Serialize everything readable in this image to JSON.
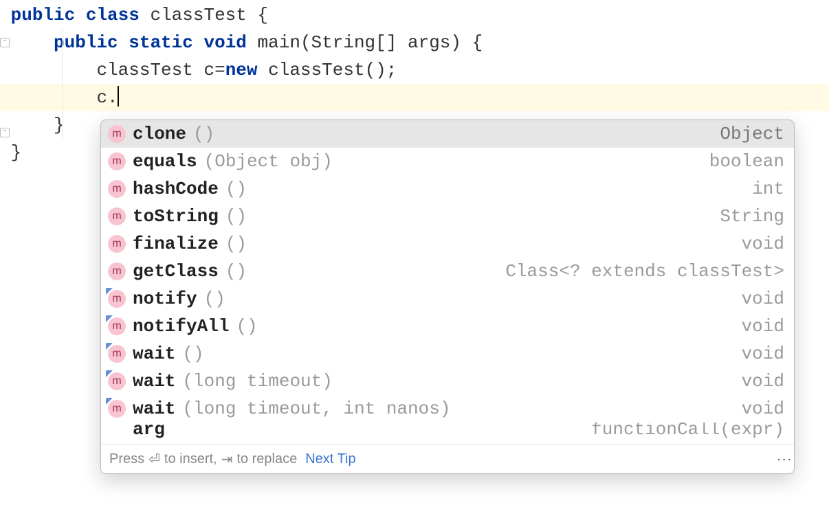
{
  "code": {
    "line1": {
      "kw_public": "public",
      "kw_class": "class",
      "className": "classTest",
      "brace": "{"
    },
    "line2": {
      "kw_public": "public",
      "kw_static": "static",
      "kw_void": "void",
      "methodName": "main",
      "params_open": "(",
      "paramType": "String",
      "brackets": "[]",
      "paramName": "args",
      "params_close": ")",
      "brace": "{"
    },
    "line3": {
      "type": "classTest",
      "var": "c",
      "equals": "=",
      "kw_new": "new",
      "ctor": "classTest",
      "parens": "()",
      "semi": ";"
    },
    "line4": {
      "obj": "c",
      "dot": "."
    },
    "line5": {
      "brace": "}"
    },
    "line6": {
      "brace": "}"
    }
  },
  "completion": {
    "items": [
      {
        "icon": "m",
        "final": false,
        "name": "clone",
        "params": "()",
        "type": "Object",
        "selected": true
      },
      {
        "icon": "m",
        "final": false,
        "name": "equals",
        "params": "(Object obj)",
        "type": "boolean",
        "selected": false
      },
      {
        "icon": "m",
        "final": false,
        "name": "hashCode",
        "params": "()",
        "type": "int",
        "selected": false
      },
      {
        "icon": "m",
        "final": false,
        "name": "toString",
        "params": "()",
        "type": "String",
        "selected": false
      },
      {
        "icon": "m",
        "final": false,
        "name": "finalize",
        "params": "()",
        "type": "void",
        "selected": false
      },
      {
        "icon": "m",
        "final": false,
        "name": "getClass",
        "params": "()",
        "type": "Class<? extends classTest>",
        "selected": false
      },
      {
        "icon": "m",
        "final": true,
        "name": "notify",
        "params": "()",
        "type": "void",
        "selected": false
      },
      {
        "icon": "m",
        "final": true,
        "name": "notifyAll",
        "params": "()",
        "type": "void",
        "selected": false
      },
      {
        "icon": "m",
        "final": true,
        "name": "wait",
        "params": "()",
        "type": "void",
        "selected": false
      },
      {
        "icon": "m",
        "final": true,
        "name": "wait",
        "params": "(long timeout)",
        "type": "void",
        "selected": false
      },
      {
        "icon": "m",
        "final": true,
        "name": "wait",
        "params": "(long timeout, int nanos)",
        "type": "void",
        "selected": false
      }
    ],
    "partial": {
      "name": "arg",
      "type": "functionCall(expr)"
    },
    "footer": {
      "press": "Press",
      "enterGlyph": "⏎",
      "insert": "to insert,",
      "tabGlyph": "⇥",
      "replace": "to replace",
      "nextTip": "Next Tip"
    }
  }
}
